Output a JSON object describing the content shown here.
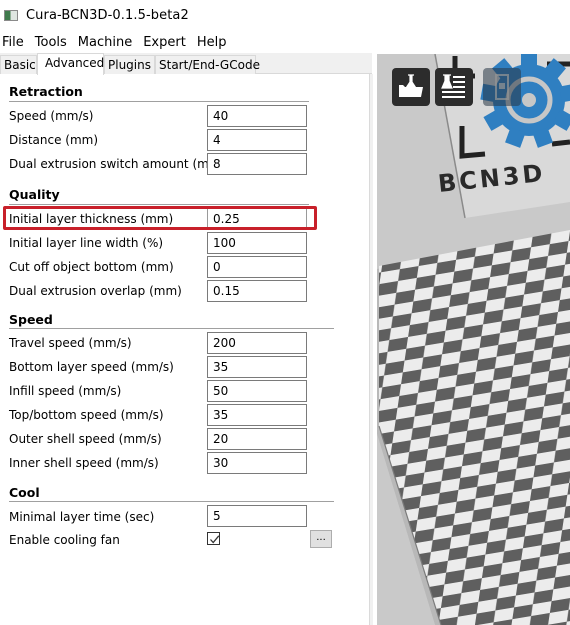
{
  "window": {
    "title": "Cura-BCN3D-0.1.5-beta2",
    "icon": "app-window-icon"
  },
  "menu": [
    "File",
    "Tools",
    "Machine",
    "Expert",
    "Help"
  ],
  "tabs": [
    {
      "label": "Basic",
      "active": false
    },
    {
      "label": "Advanced",
      "active": true
    },
    {
      "label": "Plugins",
      "active": false
    },
    {
      "label": "Start/End-GCode",
      "active": false
    }
  ],
  "sections": {
    "retraction": {
      "title": "Retraction",
      "rows": [
        {
          "label": "Speed (mm/s)",
          "value": "40"
        },
        {
          "label": "Distance (mm)",
          "value": "4"
        },
        {
          "label": "Dual extrusion switch amount (mm)",
          "value": "8"
        }
      ]
    },
    "quality": {
      "title": "Quality",
      "rows": [
        {
          "label": "Initial layer thickness (mm)",
          "value": "0.25",
          "highlighted": true
        },
        {
          "label": "Initial layer line width (%)",
          "value": "100"
        },
        {
          "label": "Cut off object bottom (mm)",
          "value": "0"
        },
        {
          "label": "Dual extrusion overlap (mm)",
          "value": "0.15"
        }
      ]
    },
    "speed": {
      "title": "Speed",
      "rows": [
        {
          "label": "Travel speed (mm/s)",
          "value": "200"
        },
        {
          "label": "Bottom layer speed (mm/s)",
          "value": "35"
        },
        {
          "label": "Infill speed (mm/s)",
          "value": "50"
        },
        {
          "label": "Top/bottom speed (mm/s)",
          "value": "35"
        },
        {
          "label": "Outer shell speed (mm/s)",
          "value": "20"
        },
        {
          "label": "Inner shell speed (mm/s)",
          "value": "30"
        }
      ]
    },
    "cool": {
      "title": "Cool",
      "rows": [
        {
          "label": "Minimal layer time (sec)",
          "value": "5"
        },
        {
          "label": "Enable cooling fan",
          "checked": true,
          "more_button": "..."
        }
      ]
    }
  },
  "viewport": {
    "toolbar": [
      {
        "name": "load-model-icon",
        "enabled": true
      },
      {
        "name": "print-gcode-icon",
        "enabled": true
      },
      {
        "name": "save-sd-icon",
        "enabled": false
      }
    ],
    "logo_text": "BCN3D",
    "colors": {
      "gear": "#2f7fc1",
      "background": "#c9c9c9",
      "checker_dark": "#5f5f5f",
      "checker_light": "#ececec",
      "highlight": "#c8202a"
    }
  }
}
